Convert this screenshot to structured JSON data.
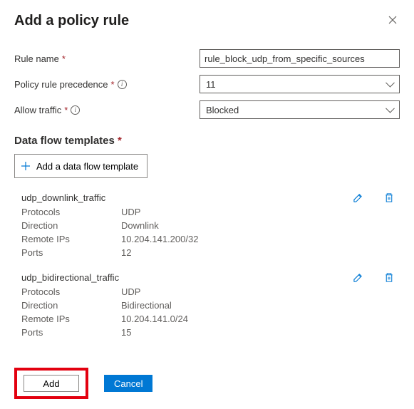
{
  "header": {
    "title": "Add a policy rule"
  },
  "form": {
    "rule_name": {
      "label": "Rule name",
      "value": "rule_block_udp_from_specific_sources"
    },
    "precedence": {
      "label": "Policy rule precedence",
      "value": "11"
    },
    "allow_traffic": {
      "label": "Allow traffic",
      "value": "Blocked"
    }
  },
  "templates_section": {
    "title": "Data flow templates",
    "add_button": "Add a data flow template"
  },
  "field_labels": {
    "protocols": "Protocols",
    "direction": "Direction",
    "remote_ips": "Remote IPs",
    "ports": "Ports"
  },
  "templates": [
    {
      "name": "udp_downlink_traffic",
      "protocols": "UDP",
      "direction": "Downlink",
      "remote_ips": "10.204.141.200/32",
      "ports": "12"
    },
    {
      "name": "udp_bidirectional_traffic",
      "protocols": "UDP",
      "direction": "Bidirectional",
      "remote_ips": "10.204.141.0/24",
      "ports": "15"
    }
  ],
  "footer": {
    "add": "Add",
    "cancel": "Cancel"
  }
}
